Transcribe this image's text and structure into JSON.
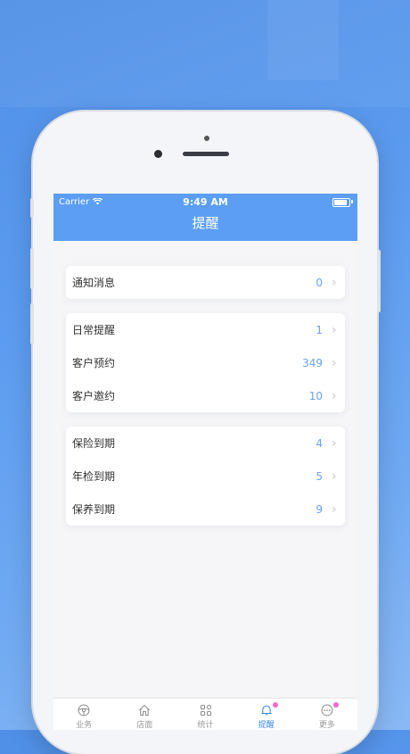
{
  "status_bar": {
    "carrier": "Carrier",
    "time": "9:49 AM"
  },
  "nav": {
    "title": "提醒"
  },
  "groups": [
    {
      "items": [
        {
          "label": "通知消息",
          "value": "0"
        }
      ]
    },
    {
      "items": [
        {
          "label": "日常提醒",
          "value": "1"
        },
        {
          "label": "客户预约",
          "value": "349"
        },
        {
          "label": "客户邀约",
          "value": "10"
        }
      ]
    },
    {
      "items": [
        {
          "label": "保险到期",
          "value": "4"
        },
        {
          "label": "年检到期",
          "value": "5"
        },
        {
          "label": "保养到期",
          "value": "9"
        }
      ]
    }
  ],
  "tabs": [
    {
      "label": "业务",
      "icon": "steering-wheel-icon"
    },
    {
      "label": "店面",
      "icon": "home-icon"
    },
    {
      "label": "统计",
      "icon": "grid-icon"
    },
    {
      "label": "提醒",
      "icon": "bell-icon",
      "active": true,
      "badge": true
    },
    {
      "label": "更多",
      "icon": "more-icon",
      "badge": true
    }
  ],
  "colors": {
    "accent": "#5b9ef4",
    "value": "#6aa3ee",
    "badge": "#f06bd0"
  }
}
